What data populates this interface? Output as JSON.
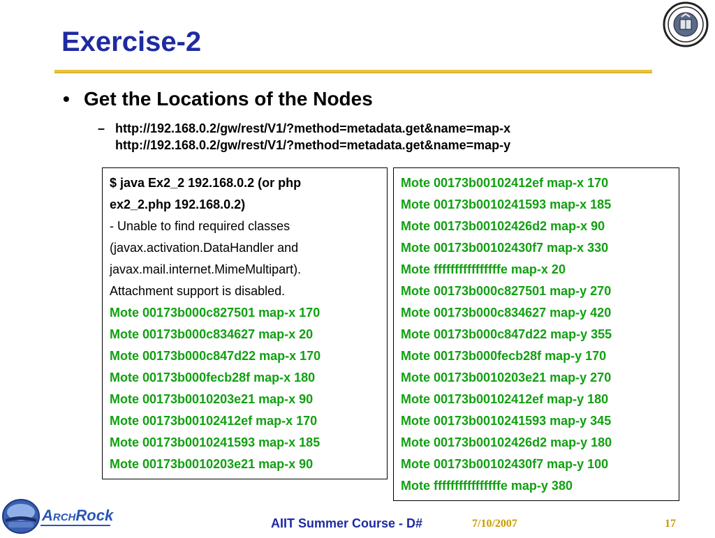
{
  "slide": {
    "title": "Exercise-2",
    "bullet": "Get the Locations of the Nodes",
    "bullet_marker": "•",
    "sub_marker": "–",
    "urls": [
      "http://192.168.0.2/gw/rest/V1/?method=metadata.get&name=map-x",
      "http://192.168.0.2/gw/rest/V1/?method=metadata.get&name=map-y"
    ]
  },
  "left_box": {
    "command_lines": [
      "$ java Ex2_2 192.168.0.2 (or php",
      "ex2_2.php 192.168.0.2)"
    ],
    "message_lines": [
      "- Unable to find required classes",
      "(javax.activation.DataHandler and",
      "javax.mail.internet.MimeMultipart).",
      "Attachment support is disabled."
    ],
    "result_lines": [
      "Mote 00173b000c827501 map-x 170",
      "Mote 00173b000c834627 map-x 20",
      "Mote 00173b000c847d22 map-x 170",
      "Mote 00173b000fecb28f map-x 180",
      "Mote 00173b0010203e21 map-x 90",
      "Mote 00173b00102412ef map-x 170",
      "Mote 00173b0010241593 map-x 185",
      "Mote 00173b0010203e21 map-x 90"
    ]
  },
  "right_box": {
    "result_lines": [
      "Mote 00173b00102412ef map-x 170",
      "Mote 00173b0010241593 map-x 185",
      "Mote 00173b00102426d2 map-x 90",
      "Mote 00173b00102430f7 map-x 330",
      "Mote ffffffffffffffffe map-x 20",
      "Mote 00173b000c827501 map-y 270",
      "Mote 00173b000c834627 map-y 420",
      "Mote 00173b000c847d22 map-y 355",
      "Mote 00173b000fecb28f map-y 170",
      "Mote 00173b0010203e21 map-y 270",
      "Mote 00173b00102412ef map-y 180",
      "Mote 00173b0010241593 map-y 345",
      "Mote 00173b00102426d2 map-y 180",
      "Mote 00173b00102430f7 map-y 100",
      "Mote ffffffffffffffffe map-y 380"
    ]
  },
  "footer": {
    "logo_arch": "Arch",
    "logo_rock": "Rock",
    "course": "AIIT Summer Course - D#",
    "date": "7/10/2007",
    "page": "17"
  },
  "colors": {
    "title": "#1e2ba0",
    "rule": "#e8c43a",
    "output_green": "#11a011",
    "footer_gold": "#c89a00"
  }
}
